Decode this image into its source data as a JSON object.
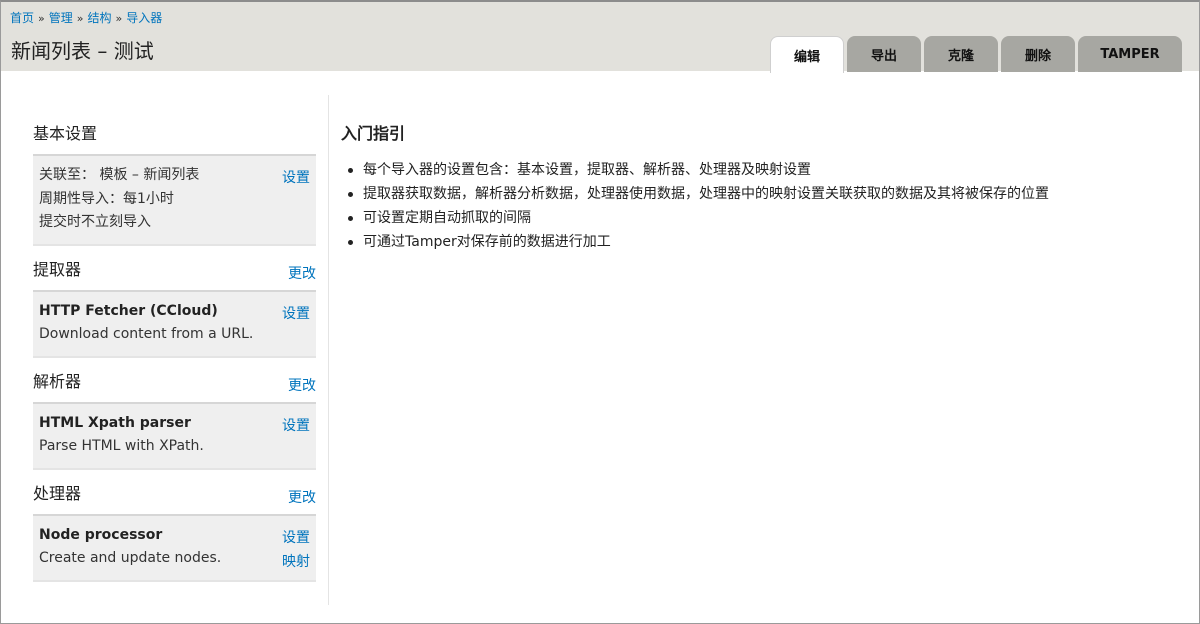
{
  "breadcrumb": {
    "items": [
      "首页",
      "管理",
      "结构",
      "导入器"
    ],
    "separator": "»"
  },
  "page": {
    "title": "新闻列表 – 测试"
  },
  "tabs": [
    {
      "label": "编辑",
      "active": true
    },
    {
      "label": "导出",
      "active": false
    },
    {
      "label": "克隆",
      "active": false
    },
    {
      "label": "删除",
      "active": false
    },
    {
      "label": "TAMPER",
      "active": false
    }
  ],
  "sidebar": {
    "basic": {
      "title": "基本设置",
      "lines": [
        "关联至： 模板 – 新闻列表",
        "周期性导入：每1小时",
        "提交时不立刻导入"
      ],
      "settings_link": "设置"
    },
    "fetcher": {
      "title": "提取器",
      "change_link": "更改",
      "name": "HTTP Fetcher (CCloud)",
      "description": "Download content from a URL.",
      "settings_link": "设置"
    },
    "parser": {
      "title": "解析器",
      "change_link": "更改",
      "name": "HTML Xpath parser",
      "description": "Parse HTML with XPath.",
      "settings_link": "设置"
    },
    "processor": {
      "title": "处理器",
      "change_link": "更改",
      "name": "Node processor",
      "description": "Create and update nodes.",
      "settings_link": "设置",
      "mapping_link": "映射"
    }
  },
  "guide": {
    "title": "入门指引",
    "items": [
      "每个导入器的设置包含：基本设置，提取器、解析器、处理器及映射设置",
      "提取器获取数据，解析器分析数据，处理器使用数据，处理器中的映射设置关联获取的数据及其将被保存的位置",
      "可设置定期自动抓取的间隔",
      "可通过Tamper对保存前的数据进行加工"
    ]
  },
  "colors": {
    "link": "#0074bd",
    "header_bg": "#e2e1dc",
    "tab_bg": "#a7a7a2",
    "panel_bg": "#efefef"
  }
}
